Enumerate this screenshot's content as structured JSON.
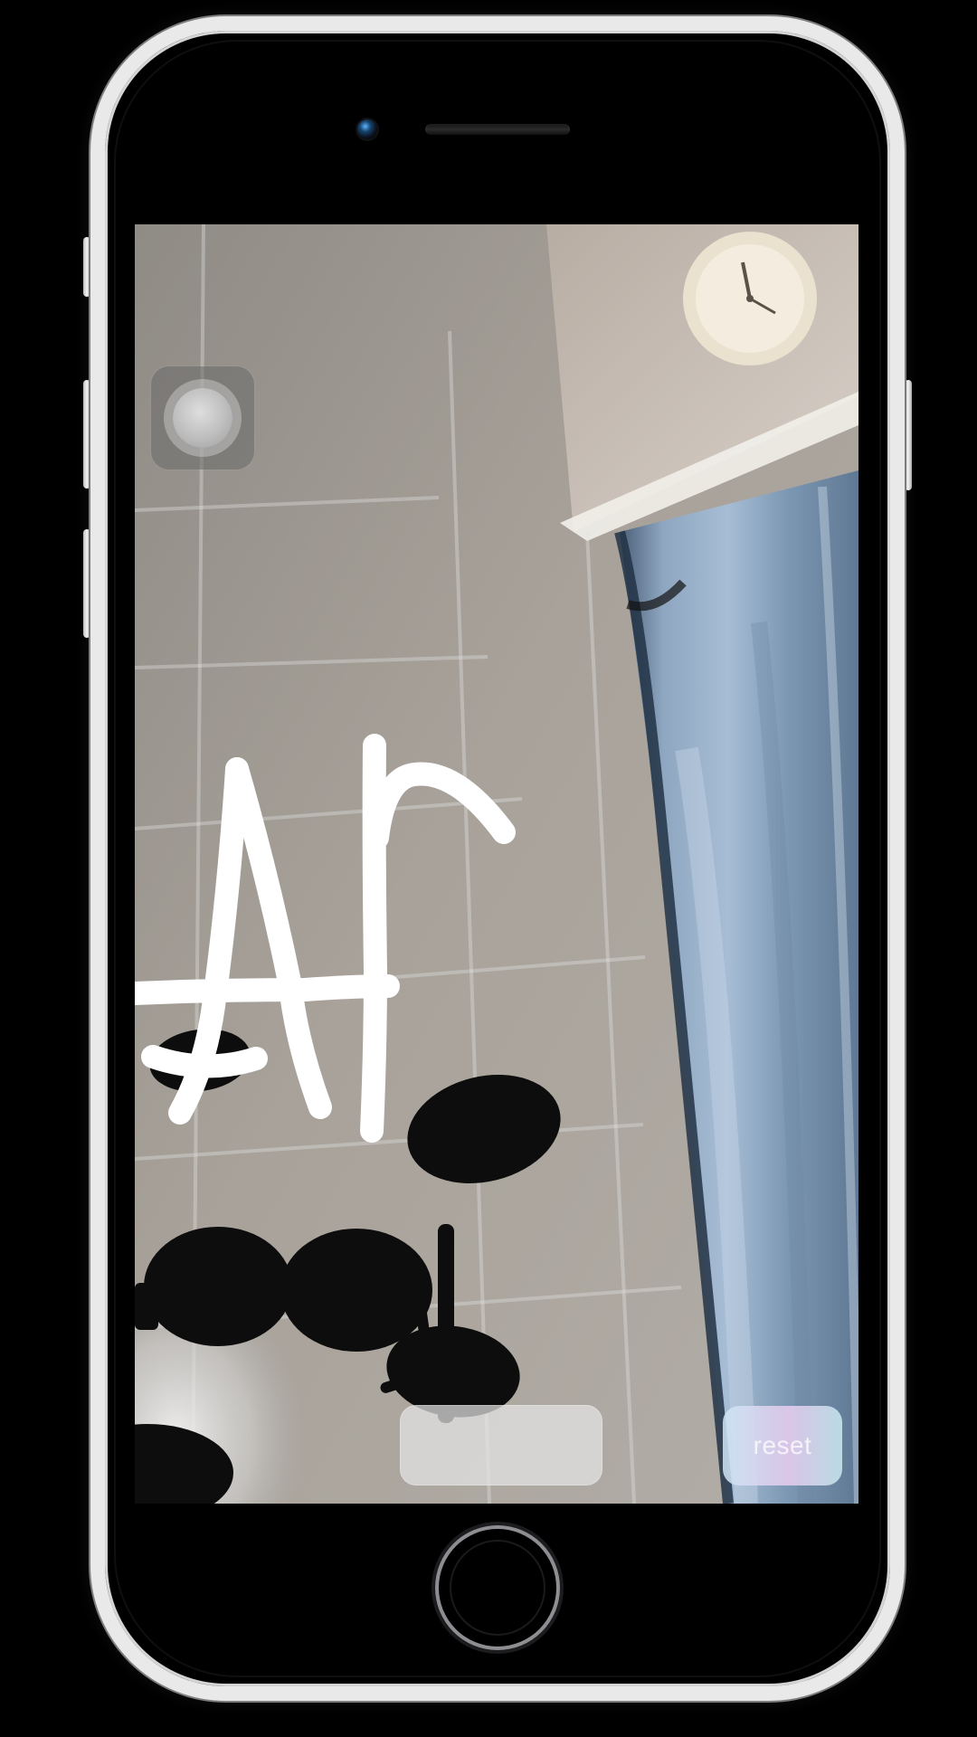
{
  "controls": {
    "reset_label": "reset"
  },
  "drawing": {
    "text": "Ar",
    "color": "#ffffff"
  },
  "icons": {
    "capture": "capture-circle-icon"
  }
}
